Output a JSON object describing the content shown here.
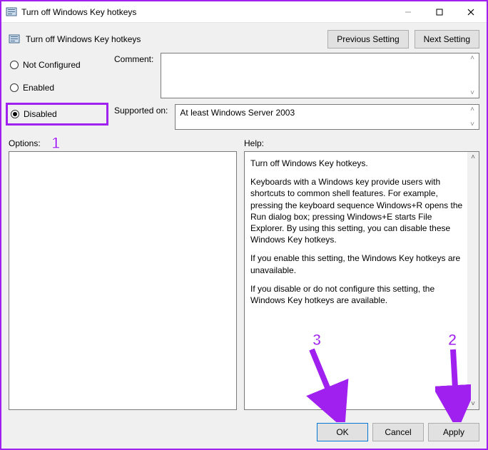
{
  "window": {
    "title": "Turn off Windows Key hotkeys",
    "header_title": "Turn off Windows Key hotkeys",
    "buttons": {
      "previous": "Previous Setting",
      "next": "Next Setting"
    }
  },
  "state_options": {
    "not_configured": "Not Configured",
    "enabled": "Enabled",
    "disabled": "Disabled",
    "selected": "disabled"
  },
  "labels": {
    "comment": "Comment:",
    "supported_on": "Supported on:",
    "options": "Options:",
    "help": "Help:"
  },
  "fields": {
    "comment_value": "",
    "supported_on_value": "At least Windows Server 2003"
  },
  "help": {
    "p1": "Turn off Windows Key hotkeys.",
    "p2": "Keyboards with a Windows key provide users with shortcuts to common shell features. For example, pressing the keyboard sequence Windows+R opens the Run dialog box; pressing Windows+E starts File Explorer. By using this setting, you can disable these Windows Key hotkeys.",
    "p3": "If you enable this setting, the Windows Key hotkeys are unavailable.",
    "p4": "If you disable or do not configure this setting, the Windows Key hotkeys are available."
  },
  "footer": {
    "ok": "OK",
    "cancel": "Cancel",
    "apply": "Apply"
  },
  "annotations": {
    "n1": "1",
    "n2": "2",
    "n3": "3"
  }
}
